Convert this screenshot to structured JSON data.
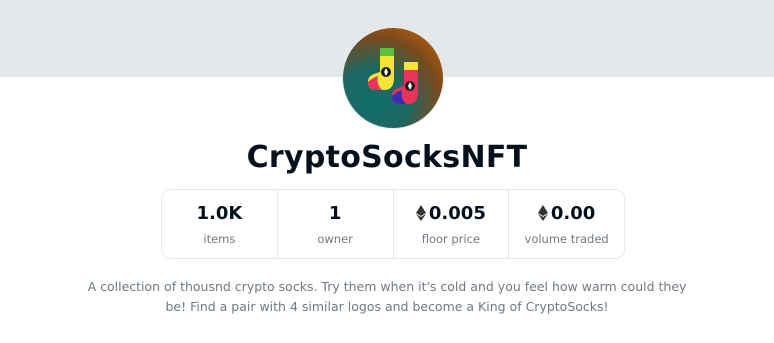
{
  "collection": {
    "name": "CryptoSocksNFT",
    "avatar_icon": "socks-icon",
    "description": "A collection of thousnd crypto socks. Try them when it's cold and you feel how warm could they be! Find a pair with 4 similar logos and become a King of CryptoSocks!"
  },
  "stats": [
    {
      "value": "1.0K",
      "label": "items",
      "icon": null
    },
    {
      "value": "1",
      "label": "owner",
      "icon": null
    },
    {
      "value": "0.005",
      "label": "floor price",
      "icon": "ethereum-icon"
    },
    {
      "value": "0.00",
      "label": "volume traded",
      "icon": "ethereum-icon"
    }
  ],
  "colors": {
    "banner": "#e5e8eb",
    "title": "#04111d",
    "muted": "#707a83"
  }
}
